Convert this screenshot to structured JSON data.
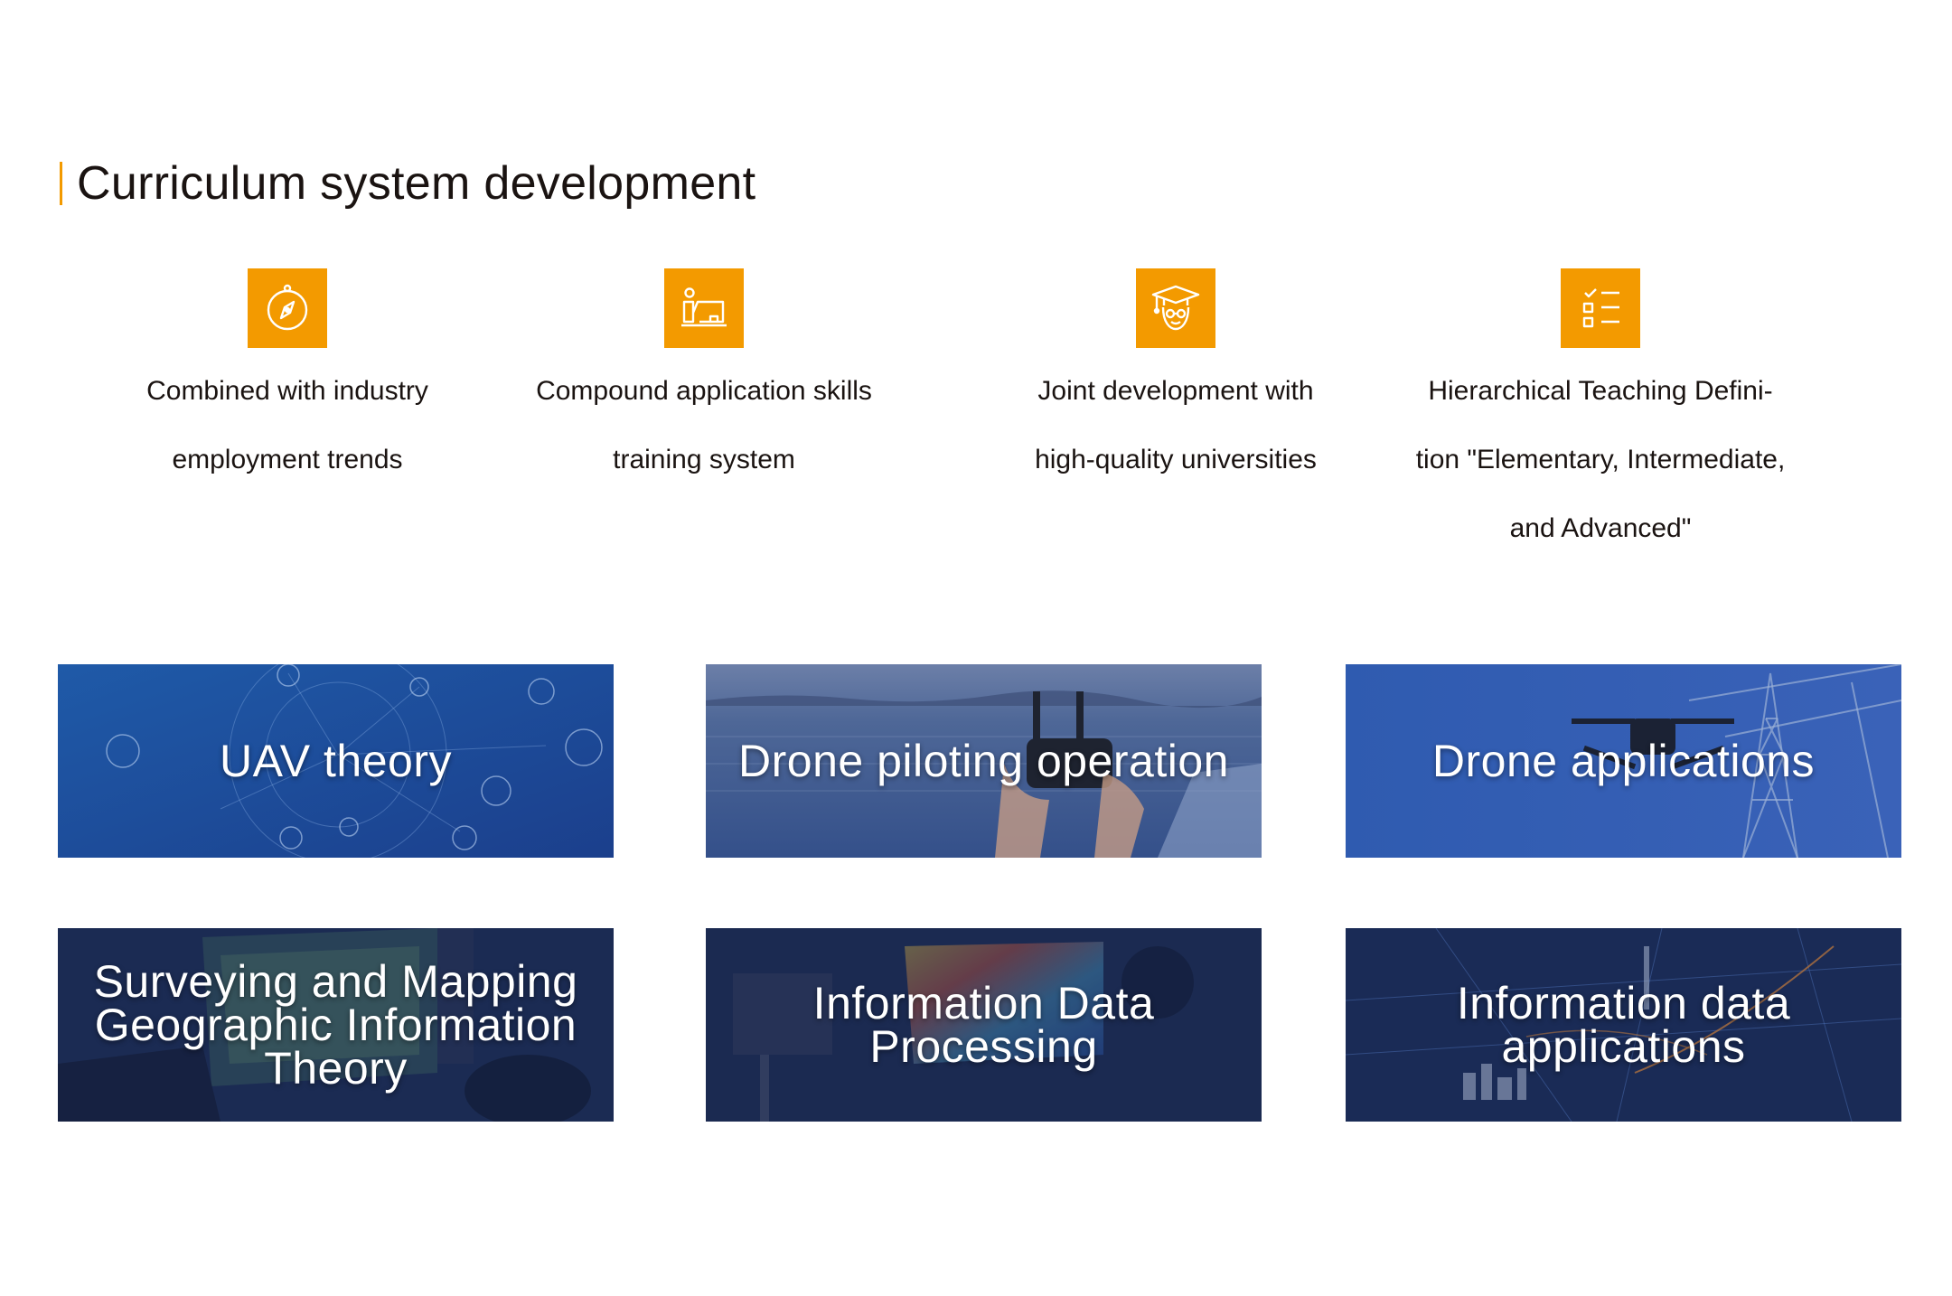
{
  "section": {
    "title": "Curriculum system development"
  },
  "features": [
    {
      "icon": "compass-icon",
      "text": "Combined with industry\nemployment trends"
    },
    {
      "icon": "person-at-screen-icon",
      "text": "Compound application skills\ntraining system"
    },
    {
      "icon": "graduate-icon",
      "text": "Joint development with\nhigh-quality universities"
    },
    {
      "icon": "checklist-icon",
      "text": "Hierarchical Teaching Defini-\ntion \"Elementary, Intermediate,\nand Advanced\""
    }
  ],
  "courses": [
    {
      "label": "UAV theory"
    },
    {
      "label": "Drone piloting operation"
    },
    {
      "label": "Drone applications"
    },
    {
      "label": "Surveying and Mapping\nGeographic Information\nTheory"
    },
    {
      "label": "Information Data\nProcessing"
    },
    {
      "label": "Information data\napplications"
    }
  ],
  "colors": {
    "accent": "#f39a00",
    "title": "#1a1311",
    "card_blue": "#2e5fae",
    "card_navy": "#1c2f5c"
  }
}
